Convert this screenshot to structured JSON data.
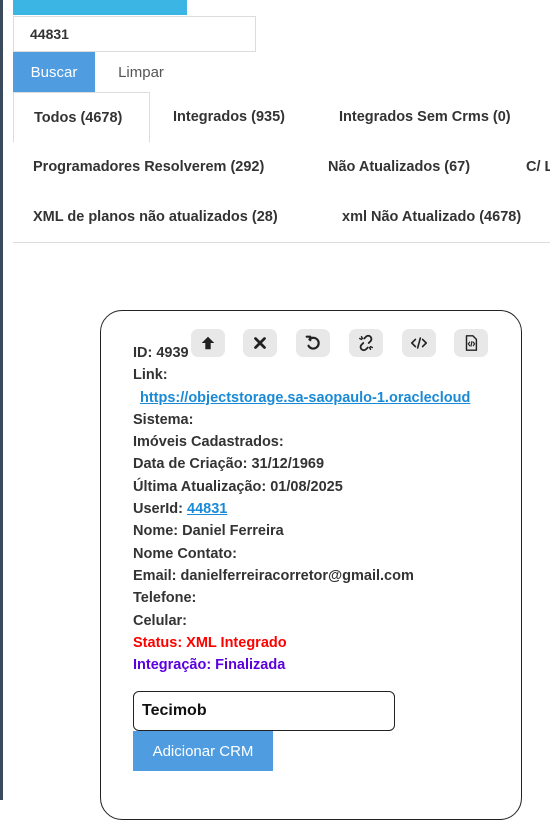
{
  "search": {
    "value": "44831"
  },
  "buttons": {
    "search_label": "Buscar",
    "clear_label": "Limpar"
  },
  "tabs": [
    {
      "label": "Todos (4678)",
      "active": true
    },
    {
      "label": "Integrados (935)"
    },
    {
      "label": "Integrados Sem Crms (0)"
    },
    {
      "label": "Programadores Resolverem (292)"
    },
    {
      "label": "Não Atualizados (67)"
    },
    {
      "label": "C/ L"
    },
    {
      "label": "XML de planos não atualizados (28)"
    },
    {
      "label": "xml Não Atualizado (4678)"
    }
  ],
  "toolbar": {
    "icons": [
      "arrow-up-icon",
      "close-icon",
      "undo-icon",
      "broken-link-icon",
      "code-icon",
      "code-file-icon"
    ]
  },
  "record": {
    "id": "ID: 4939",
    "link_label": "Link:",
    "link_url": "https://objectstorage.sa-saopaulo-1.oraclecloud",
    "sistema": "Sistema:",
    "imoveis": "Imóveis Cadastrados:",
    "data_criacao": "Data de Criação: 31/12/1969",
    "ultima_atualizacao": "Última Atualização: 01/08/2025",
    "userid_label": "UserId: ",
    "userid_value": "44831",
    "nome": "Nome: Daniel Ferreira",
    "nome_contato": "Nome Contato:",
    "email": "Email: danielferreiracorretor@gmail.com",
    "telefone": "Telefone:",
    "celular": "Celular:",
    "status": "Status: XML Integrado",
    "integracao": "Integração: Finalizada"
  },
  "crm": {
    "input_value": "Tecimob",
    "add_label": "Adicionar CRM"
  },
  "colors": {
    "accent": "#4f9de0",
    "top_strip": "#3bb6e4",
    "status": "#ff0000",
    "integration": "#5b00e0",
    "link": "#1a8ad6"
  }
}
